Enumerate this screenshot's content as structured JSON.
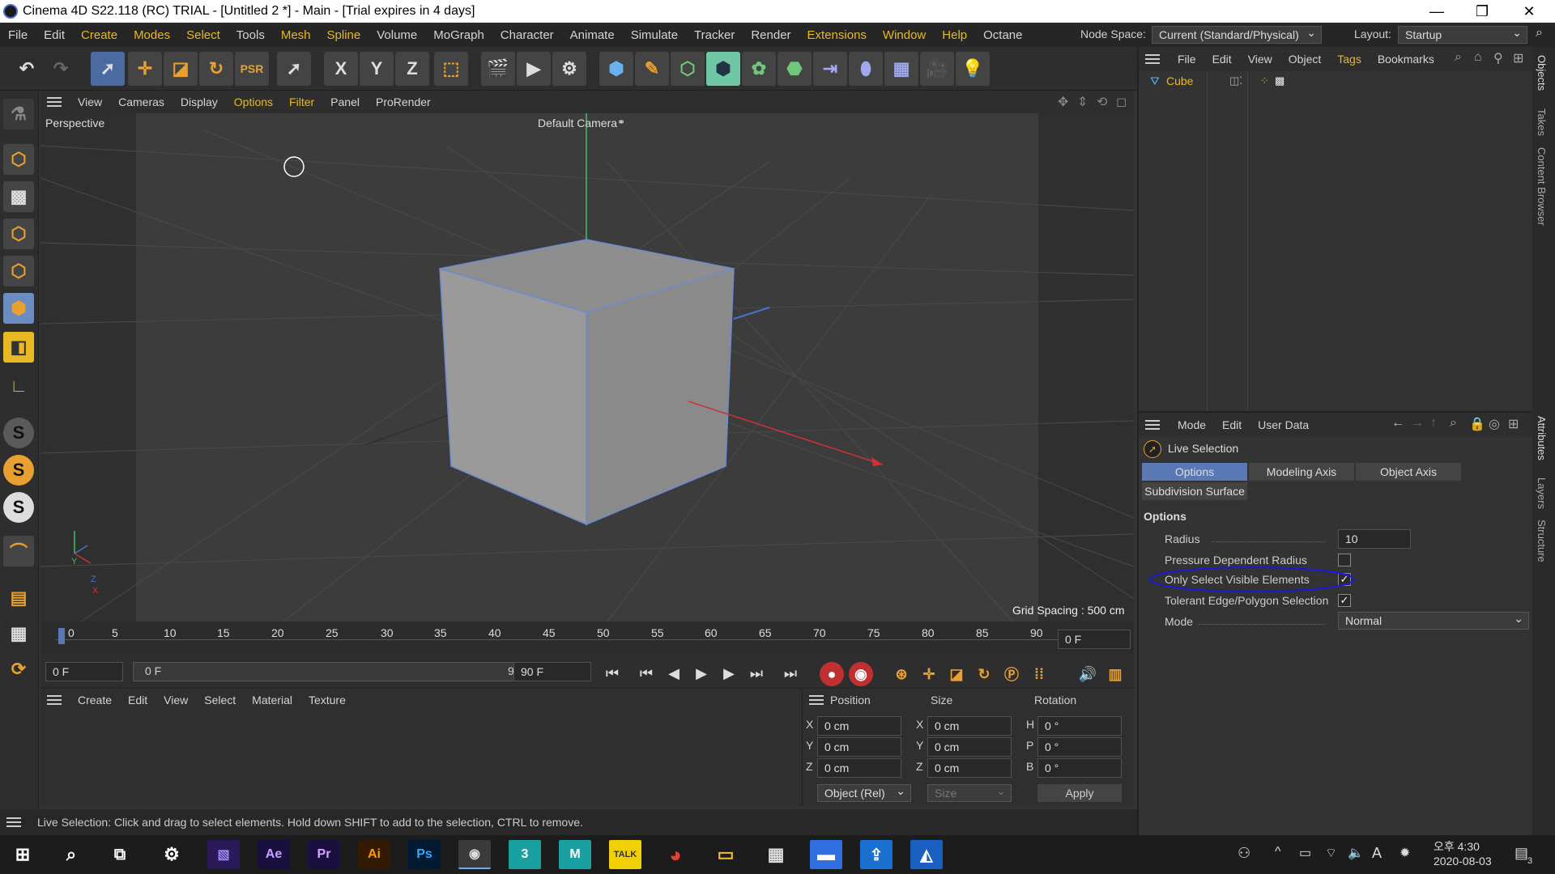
{
  "window": {
    "title": "Cinema 4D S22.118 (RC) TRIAL - [Untitled 2 *] - Main - [Trial expires in 4 days]",
    "minimize": "—",
    "maximize": "❐",
    "close": "✕"
  },
  "menu": [
    "File",
    "Edit",
    "Create",
    "Modes",
    "Select",
    "Tools",
    "Mesh",
    "Spline",
    "Volume",
    "MoGraph",
    "Character",
    "Animate",
    "Simulate",
    "Tracker",
    "Render",
    "Extensions",
    "Window",
    "Help",
    "Octane"
  ],
  "node_space": {
    "label": "Node Space:",
    "value": "Current (Standard/Physical)"
  },
  "layout": {
    "label": "Layout:",
    "value": "Startup"
  },
  "toolbar": {
    "x": "X",
    "y": "Y",
    "z": "Z"
  },
  "view_menu": [
    "View",
    "Cameras",
    "Display",
    "Options",
    "Filter",
    "Panel",
    "ProRender"
  ],
  "viewport": {
    "label": "Perspective",
    "camera": "Default Camera",
    "grid_spacing": "Grid Spacing : 500 cm",
    "axis_y": "Y",
    "axis_z": "Z",
    "axis_x": "X"
  },
  "timeline": {
    "ticks": [
      "0",
      "5",
      "10",
      "15",
      "20",
      "25",
      "30",
      "35",
      "40",
      "45",
      "50",
      "55",
      "60",
      "65",
      "70",
      "75",
      "80",
      "85",
      "90"
    ],
    "current": "0 F"
  },
  "transport": {
    "start": "0 F",
    "range_start": "0 F",
    "range_end": "90 F",
    "end": "90 F"
  },
  "material_menu": [
    "Create",
    "Edit",
    "View",
    "Select",
    "Material",
    "Texture"
  ],
  "coords": {
    "headers": [
      "Position",
      "Size",
      "Rotation"
    ],
    "rows": [
      {
        "a": "X",
        "pos": "0 cm",
        "b": "X",
        "size": "0 cm",
        "c": "H",
        "rot": "0 °"
      },
      {
        "a": "Y",
        "pos": "0 cm",
        "b": "Y",
        "size": "0 cm",
        "c": "P",
        "rot": "0 °"
      },
      {
        "a": "Z",
        "pos": "0 cm",
        "b": "Z",
        "size": "0 cm",
        "c": "B",
        "rot": "0 °"
      }
    ],
    "mode": "Object (Rel)",
    "size_mode": "Size",
    "apply": "Apply"
  },
  "status": "Live Selection: Click and drag to select elements. Hold down SHIFT to add to the selection, CTRL to remove.",
  "objects_menu": [
    "File",
    "Edit",
    "View",
    "Object",
    "Tags",
    "Bookmarks"
  ],
  "object_item": "Cube",
  "attr_menu": [
    "Mode",
    "Edit",
    "User Data"
  ],
  "attr": {
    "tool": "Live Selection",
    "tabs": [
      "Options",
      "Modeling Axis",
      "Object Axis"
    ],
    "tab2": "Subdivision Surface",
    "section": "Options",
    "radius_label": "Radius",
    "radius_value": "10",
    "pressure": "Pressure Dependent Radius",
    "only_visible": "Only Select Visible Elements",
    "tolerant": "Tolerant Edge/Polygon Selection",
    "mode_label": "Mode",
    "mode_value": "Normal"
  },
  "side_tabs": [
    "Objects",
    "Takes",
    "Content Browser",
    "Attributes",
    "Layers",
    "Structure"
  ],
  "taskbar": {
    "time": "오후 4:30",
    "date": "2020-08-03",
    "ime": "A",
    "notif": "3",
    "apps": [
      "Ae",
      "Pr",
      "Ai",
      "Ps",
      "3",
      "M",
      "TALK"
    ]
  },
  "colors": {
    "accent": "#e8b923",
    "selection_blue": "#5a78b4",
    "annotation": "#1a1adb"
  }
}
